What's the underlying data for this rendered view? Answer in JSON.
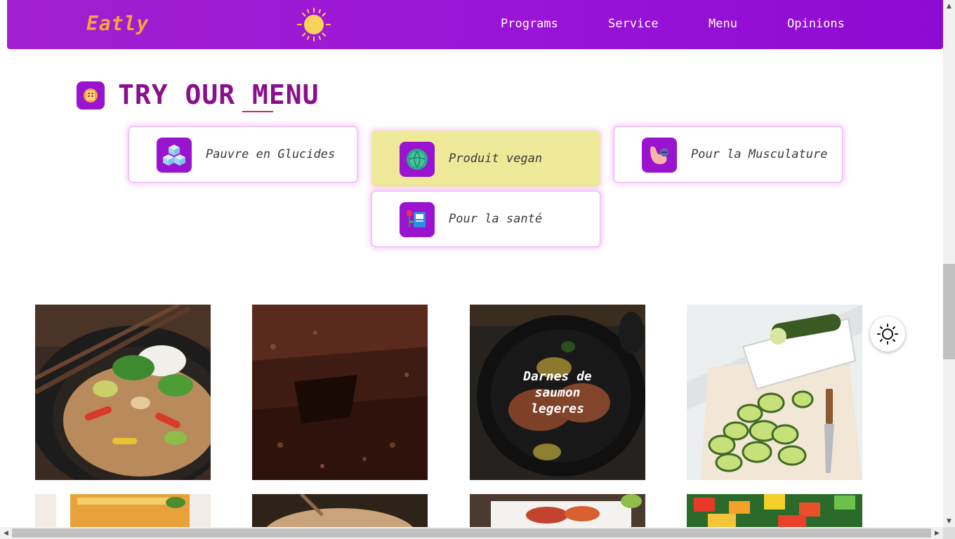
{
  "header": {
    "logo": "Eatly",
    "nav": [
      "Programs",
      "Service",
      "Menu",
      "Opinions"
    ]
  },
  "section": {
    "title_part1": "TRY OUR ",
    "title_part2": "MENU"
  },
  "categories": [
    {
      "label": "Pauvre en Glucides",
      "icon": "sugar-cubes-icon",
      "active": false
    },
    {
      "label": "Produit vegan",
      "icon": "cabbage-icon",
      "active": true
    },
    {
      "label": "Pour la Musculature",
      "icon": "muscle-arm-icon",
      "active": false
    },
    {
      "label": "Pour la santé",
      "icon": "flower-book-icon",
      "active": false
    }
  ],
  "dishes": [
    {
      "name": "thai-curry-bowl",
      "caption": ""
    },
    {
      "name": "brownie",
      "caption": ""
    },
    {
      "name": "salmon-steaks",
      "caption": "Darnes de saumon legeres"
    },
    {
      "name": "zucchini-slices",
      "caption": ""
    }
  ],
  "colors": {
    "header_gradient_start": "#a21fcf",
    "header_gradient_end": "#8e0bd4",
    "logo": "#f7a13b",
    "title": "#8a0f8c",
    "accent_underline": "#d6235a",
    "icon_bg": "#9a13cf",
    "active_card": "#efe99a"
  }
}
